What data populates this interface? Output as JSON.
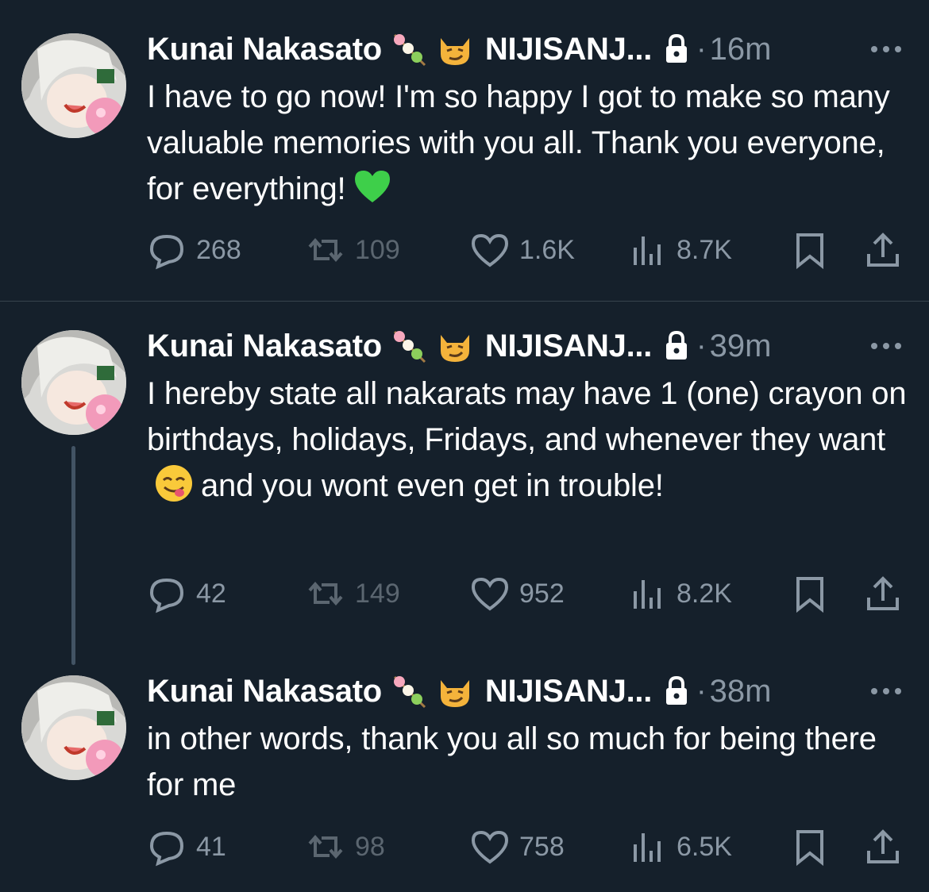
{
  "colors": {
    "background": "#15202b",
    "text": "#ffffff",
    "secondary": "#8b98a5",
    "divider": "#38444d",
    "heart_emoji": "#3ecf4a"
  },
  "tweets": [
    {
      "author": "Kunai Nakasato",
      "name_emojis": [
        "dango-emoji",
        "smirking-cat-emoji"
      ],
      "affiliation": "NIJISANJ...",
      "dot": "·",
      "time": "16m",
      "text_parts": [
        "I have to go now! I'm so happy I got to make so many valuable memories with you all. Thank you everyone, for everything!"
      ],
      "inline_emoji": "green-heart-emoji",
      "replies": "268",
      "retweets": "109",
      "likes": "1.6K",
      "views": "8.7K"
    },
    {
      "author": "Kunai Nakasato",
      "name_emojis": [
        "dango-emoji",
        "smirking-cat-emoji"
      ],
      "affiliation": "NIJISANJ...",
      "dot": "·",
      "time": "39m",
      "text_parts": [
        "I hereby state all nakarats may have 1 (one) crayon on birthdays, holidays, Fridays, and whenever they want",
        "and you wont even get in trouble!"
      ],
      "inline_emoji": "yummy-face-emoji",
      "replies": "42",
      "retweets": "149",
      "likes": "952",
      "views": "8.2K"
    },
    {
      "author": "Kunai Nakasato",
      "name_emojis": [
        "dango-emoji",
        "smirking-cat-emoji"
      ],
      "affiliation": "NIJISANJ...",
      "dot": "·",
      "time": "38m",
      "text_parts": [
        "in other words, thank you all so much for being there for me"
      ],
      "replies": "41",
      "retweets": "98",
      "likes": "758",
      "views": "6.5K"
    }
  ]
}
